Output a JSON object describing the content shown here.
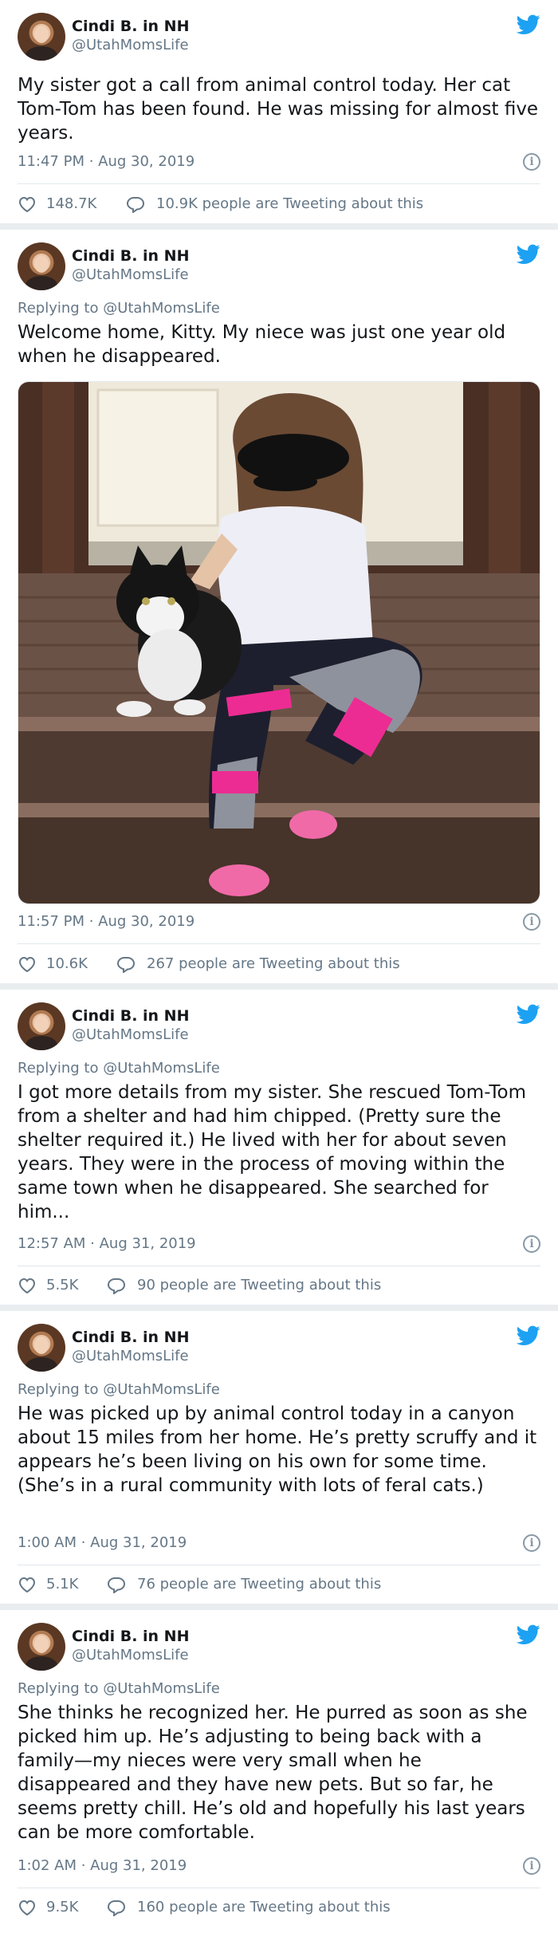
{
  "author": {
    "name": "Cindi B. in NH",
    "handle": "@UtahMomsLife"
  },
  "colors": {
    "brand_blue": "#1da1f2",
    "muted": "#657786",
    "text": "#14171a"
  },
  "tweets": [
    {
      "replying_to": "",
      "text": "My sister got a call from animal control today. Her cat Tom-Tom has been found. He was missing for almost five years.",
      "timestamp": "11:47 PM · Aug 30, 2019",
      "likes": "148.7K",
      "talking": "10.9K people are Tweeting about this"
    },
    {
      "replying_to": "Replying to @UtahMomsLife",
      "text": "Welcome home, Kitty. My niece was just one year old when he disappeared.",
      "timestamp": "11:57 PM · Aug 30, 2019",
      "likes": "10.6K",
      "talking": "267 people are Tweeting about this"
    },
    {
      "replying_to": "Replying to @UtahMomsLife",
      "text": "I got more details from my sister. She rescued Tom-Tom from a shelter and had him chipped. (Pretty sure the shelter required it.) He lived with her for about seven years. They were in the process of moving within the same town when he disappeared. She searched for him...",
      "timestamp": "12:57 AM · Aug 31, 2019",
      "likes": "5.5K",
      "talking": "90 people are Tweeting about this"
    },
    {
      "replying_to": "Replying to @UtahMomsLife",
      "text": "He was picked up by animal control today in a canyon about 15 miles from her home. He’s pretty scruffy and it appears he’s been living on his own for some time. (She’s in a rural community with lots of feral cats.)",
      "timestamp": "1:00 AM · Aug 31, 2019",
      "likes": "5.1K",
      "talking": "76 people are Tweeting about this"
    },
    {
      "replying_to": "Replying to @UtahMomsLife",
      "text": "She thinks he recognized her. He purred as soon as she picked him up. He’s adjusting to being back with a family—my nieces were very small when he disappeared and they have new pets. But so far, he seems pretty chill. He’s old and hopefully his last years can be more comfortable.",
      "timestamp": "1:02 AM · Aug 31, 2019",
      "likes": "9.5K",
      "talking": "160 people are Tweeting about this"
    }
  ],
  "icons": {
    "bird": "twitter-bird-icon",
    "info": "info-icon",
    "like": "heart-icon",
    "reply": "speech-bubble-icon"
  }
}
